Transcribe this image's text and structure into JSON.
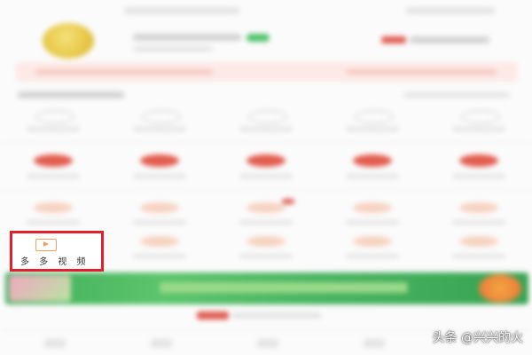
{
  "highlighted_item": {
    "icon": "play-video-icon",
    "label": "多 多 视 频"
  },
  "watermark": {
    "text": "头条 @兴兴的火"
  },
  "colors": {
    "highlight_border": "#e0202a",
    "icon_accent": "#f0a060",
    "banner_green": "#4ab760",
    "row_red": "#e35d4f"
  }
}
